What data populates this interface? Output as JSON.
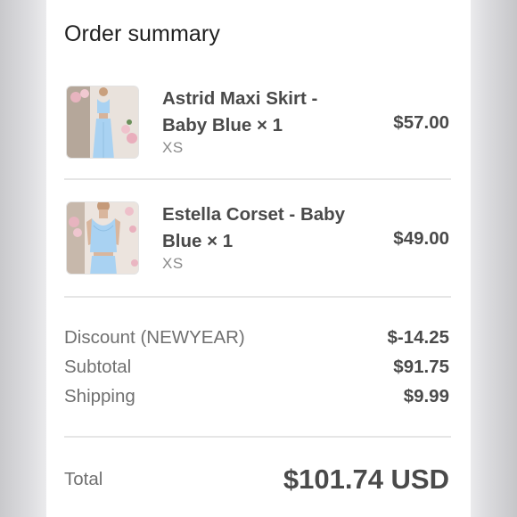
{
  "summary": {
    "title": "Order summary"
  },
  "items": [
    {
      "name": "Astrid Maxi Skirt - Baby Blue × 1",
      "variant": "XS",
      "price": "$57.00",
      "thumbnail_icon": "skirt-product-photo"
    },
    {
      "name": "Estella Corset - Baby Blue × 1",
      "variant": "XS",
      "price": "$49.00",
      "thumbnail_icon": "corset-product-photo"
    }
  ],
  "costs": {
    "discount_label": "Discount (NEWYEAR)",
    "discount_value": "$-14.25",
    "subtotal_label": "Subtotal",
    "subtotal_value": "$91.75",
    "shipping_label": "Shipping",
    "shipping_value": "$9.99"
  },
  "total": {
    "label": "Total",
    "value": "$101.74 USD"
  },
  "colors": {
    "garment": "#a9d2f2",
    "text_dark": "#4a4a4a",
    "text_muted": "#707070"
  }
}
